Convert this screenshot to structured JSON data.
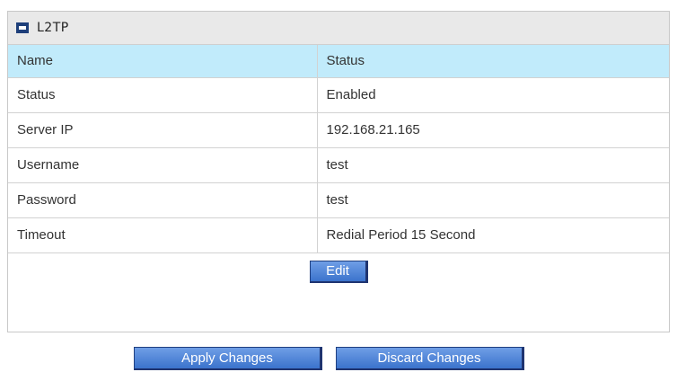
{
  "panel": {
    "title": "L2TP",
    "icon": "arrow-right-icon"
  },
  "table": {
    "header": {
      "name": "Name",
      "status": "Status"
    },
    "rows": [
      {
        "name": "Status",
        "value": "Enabled"
      },
      {
        "name": "Server IP",
        "value": "192.168.21.165"
      },
      {
        "name": "Username",
        "value": "test"
      },
      {
        "name": "Password",
        "value": "test"
      },
      {
        "name": "Timeout",
        "value": "Redial Period 15 Second"
      }
    ]
  },
  "buttons": {
    "edit": "Edit",
    "apply": "Apply Changes",
    "discard": "Discard Changes"
  },
  "colors": {
    "header_row_bg": "#c1ebfb",
    "panel_header_bg": "#e9e9e9",
    "button_blue": "#3b73cc",
    "icon_navy": "#1e3f7a"
  }
}
